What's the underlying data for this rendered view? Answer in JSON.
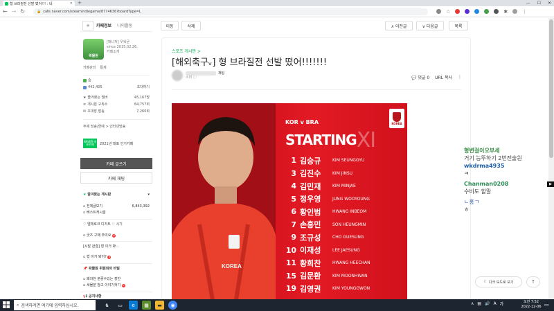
{
  "browser": {
    "tab_title": "형 브라질전 선발 떴어!!! : 네",
    "new_tab": "+",
    "url": "cafe.naver.com/steamindiegame/8774636?boardType=L",
    "window_controls": [
      "—",
      "☐",
      "✕"
    ]
  },
  "sidebar": {
    "tabs": [
      "카페정보",
      "나의활동"
    ],
    "cafe_icon_text": "왁물원",
    "cafe_meta": [
      "[매니저] 우왁굳",
      "since 2015.02.26.",
      "카페소개"
    ],
    "manage_links": [
      "카페관리",
      "통계"
    ],
    "stats": [
      {
        "label": "숲",
        "value": ""
      },
      {
        "label": "442,405",
        "value": "초대하기"
      },
      {
        "label": "즐겨찾는 멤버",
        "value": "45,167명"
      },
      {
        "label": "게시판 구독수",
        "value": "84,757회"
      },
      {
        "label": "초대장 발송",
        "value": "7,260회"
      }
    ],
    "topic": "주제  방송/연예 > 인터넷방송",
    "award_badge": "NAVER 대표카페",
    "award_text": "2021년 대표 인기카페",
    "write_button": "카페 글쓰기",
    "chat_button": "카페 채팅",
    "fav_header": "즐겨찾는 게시판",
    "fav_boards": [
      {
        "name": "전체글보기",
        "count": "6,843,392"
      },
      {
        "name": "베스트게시글",
        "count": ""
      }
    ],
    "promo_1": "♡ 엘제로크 디저트 ♡ 시기",
    "promo_1_sub": "굿즈 구매 주의요",
    "promo_2": "[시발 완결] 형 이거 봐...",
    "promo_2_sub": "형 이거 봐어?",
    "sec_3_header": "왁물원 위원회의 비밀",
    "sec_3_items": [
      "왜의한 분증수있는 장한",
      "세물분 참고 이야기하기"
    ],
    "sec_4_header": "공지사항"
  },
  "toolbar": {
    "move": "이동",
    "delete": "삭제",
    "prev": "∧ 이전글",
    "next": "∨ 다음글",
    "list": "목록"
  },
  "article": {
    "board_name": "스포츠 게시판 >",
    "title": "[해외축구ᵥ] 형 브라질전 선발 떴어!!!!!!!",
    "author_name": "채팅",
    "author_meta": "소퍼 ⓘ",
    "comments": "댓글 0",
    "copy_url": "URL 복사",
    "more": "⋮"
  },
  "poster": {
    "kor_bra": "KOR v BRA",
    "starting": "STARTING",
    "xi": "XI",
    "badge": "KOREA",
    "players": [
      {
        "num": "1",
        "kr": "김승규",
        "en": "KIM SEUNGGYU"
      },
      {
        "num": "3",
        "kr": "김진수",
        "en": "KIM JINSU"
      },
      {
        "num": "4",
        "kr": "김민재",
        "en": "KIM MINJAE"
      },
      {
        "num": "5",
        "kr": "정우영",
        "en": "JUNG WOOYOUNG"
      },
      {
        "num": "6",
        "kr": "황인범",
        "en": "HWANG INBEOM"
      },
      {
        "num": "7",
        "kr": "손흥민",
        "en": "SON HEUNGMIN"
      },
      {
        "num": "9",
        "kr": "조규성",
        "en": "CHO GUESUNG"
      },
      {
        "num": "10",
        "kr": "이재성",
        "en": "LEE JAESUNG"
      },
      {
        "num": "11",
        "kr": "황희찬",
        "en": "HWANG HEECHAN"
      },
      {
        "num": "15",
        "kr": "김문환",
        "en": "KIM MOONHWAN"
      },
      {
        "num": "19",
        "kr": "김영권",
        "en": "KIM YOUNGGWON"
      }
    ],
    "colors": {
      "red": "#d5131f",
      "white": "#ffffff"
    }
  },
  "chat": [
    {
      "name": "형변걸이오부세",
      "msg": "거기 능뚜하기 2번전술원"
    },
    {
      "name": "wkdrma4935",
      "msg": "ㅋ"
    },
    {
      "name": "Chanman0208",
      "msg": "수비도 할말"
    },
    {
      "name": "",
      "msg": "ㄴ홍ㄱ"
    },
    {
      "name": "",
      "msg": "ㅎ"
    }
  ],
  "floating": {
    "dark_mode": "다크 모드로 보기",
    "top": "↑"
  },
  "taskbar": {
    "search_placeholder": "검색하려면 여기에 입력하십시오.",
    "time": "오전 7:52",
    "date": "2022-12-06",
    "lang": "A",
    "ime": "가"
  }
}
